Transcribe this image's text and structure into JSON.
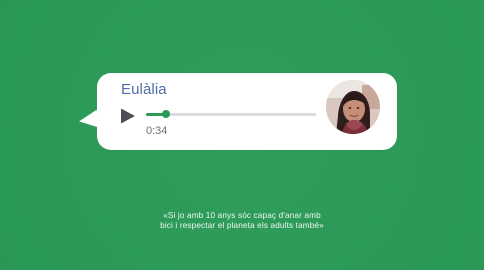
{
  "message": {
    "sender_name": "Eulàlia",
    "duration": "0:34",
    "progress": 0.12,
    "colors": {
      "background": "#2a9a57",
      "bubble": "#ffffff",
      "name": "#4f6ca8",
      "accent": "#2a9a57",
      "track": "#d9dde0"
    },
    "icons": {
      "play": "play-icon",
      "avatar": "portrait-photo"
    }
  },
  "caption": {
    "line_1": "«Si jo amb 10 anys sóc capaç d'anar amb",
    "line_2": "bici i respectar el planeta els adults també»"
  }
}
